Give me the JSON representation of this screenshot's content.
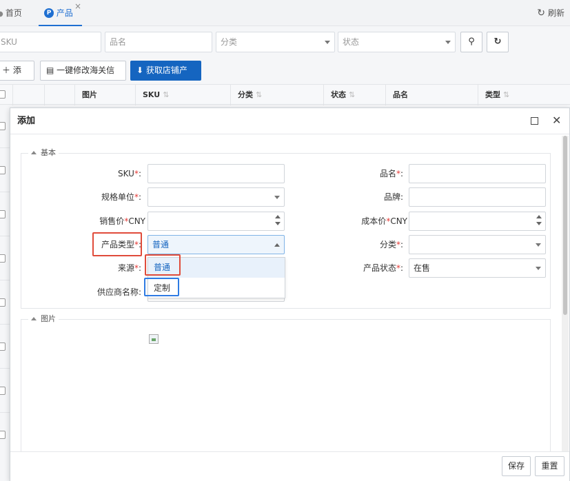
{
  "tabs": {
    "home_label": "首页",
    "product_label": "产品",
    "product_badge": "P",
    "refresh_label": "刷新"
  },
  "filters": {
    "sku_placeholder": "SKU",
    "name_placeholder": "品名",
    "category_placeholder": "分类",
    "status_placeholder": "状态"
  },
  "toolbar": {
    "add_label": "添加",
    "customs_label": "一键修改海关信息",
    "fetch_label": "获取店铺产品"
  },
  "table": {
    "columns": [
      "图片",
      "SKU",
      "分类",
      "状态",
      "品名",
      "类型"
    ]
  },
  "modal": {
    "title": "添加",
    "basic_section": "基本",
    "image_section": "图片",
    "fields": {
      "sku": "SKU",
      "spec_unit": "规格单位",
      "sale_price_prefix": "销售价",
      "sale_price_unit": "CNY",
      "product_type": "产品类型",
      "source": "来源",
      "supplier": "供应商名称:",
      "product_name": "品名",
      "brand": "品牌:",
      "cost_prefix": "成本价",
      "cost_unit": "CNY",
      "category": "分类",
      "product_status": "产品状态"
    },
    "values": {
      "product_type": "普通",
      "product_status": "在售"
    },
    "dropdown_options": [
      "普通",
      "定制"
    ],
    "save_label": "保存",
    "reset_label": "重置"
  }
}
